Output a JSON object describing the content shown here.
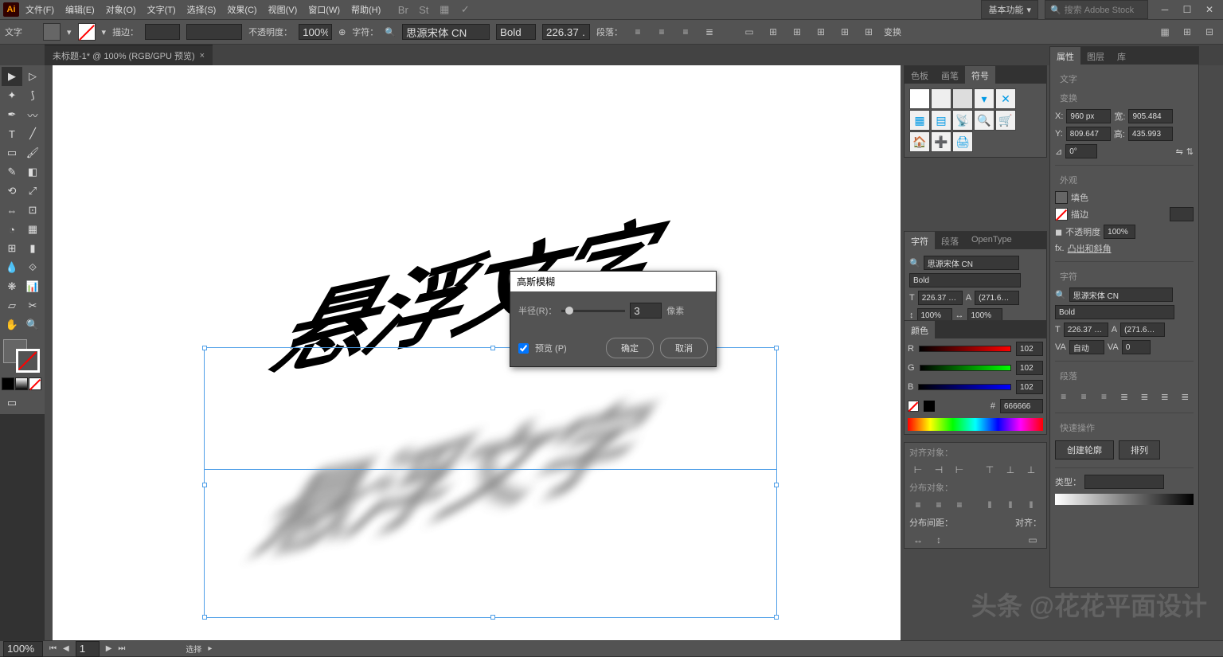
{
  "menu": {
    "items": [
      "文件(F)",
      "编辑(E)",
      "对象(O)",
      "文字(T)",
      "选择(S)",
      "效果(C)",
      "视图(V)",
      "窗口(W)",
      "帮助(H)"
    ],
    "workspace": "基本功能",
    "search_ph": "搜索 Adobe Stock"
  },
  "control": {
    "tool": "文字",
    "stroke_label": "描边：",
    "opacity_label": "不透明度：",
    "opacity": "100%",
    "char_label": "字符：",
    "font": "思源宋体 CN",
    "weight": "Bold",
    "size": "226.37 …",
    "para_label": "段落：",
    "transform": "变换"
  },
  "tab": {
    "title": "未标题-1* @ 100% (RGB/GPU 预览)"
  },
  "canvas": {
    "text": "悬浮文字"
  },
  "dialog": {
    "title": "高斯模糊",
    "radius_label": "半径(R)：",
    "value": "3",
    "unit": "像素",
    "preview": "预览 (P)",
    "ok": "确定",
    "cancel": "取消"
  },
  "panel_symbols": {
    "tabs": [
      "色板",
      "画笔",
      "符号"
    ]
  },
  "panel_char": {
    "tabs": [
      "字符",
      "段落",
      "OpenType"
    ],
    "font": "思源宋体 CN",
    "weight": "Bold",
    "size": "226.37 …",
    "leading": "(271.6…",
    "hscale": "100%",
    "vscale": "100%"
  },
  "panel_color": {
    "title": "颜色",
    "r": "102",
    "g": "102",
    "b": "102",
    "hex": "666666"
  },
  "panel_align": {
    "align_label": "对齐对象：",
    "dist_label": "分布对象：",
    "spacing": "分布间距：",
    "align_to": "对齐："
  },
  "panel_props": {
    "tabs": [
      "属性",
      "图层",
      "库"
    ],
    "tool": "文字",
    "transform": "变换",
    "x": "960 px",
    "y": "809.647",
    "w": "905.484",
    "h": "435.993",
    "angle": "0°",
    "appearance": "外观",
    "fill": "填色",
    "stroke": "描边",
    "opacity_l": "不透明度",
    "opacity": "100%",
    "fx": "fx.",
    "fx_label": "凸出和斜角",
    "char_section": "字符",
    "font": "思源宋体 CN",
    "weight": "Bold",
    "size": "226.37 …",
    "leading": "(271.6…",
    "auto": "自动",
    "kern": "0",
    "para_section": "段落",
    "actions": "快速操作",
    "outline": "创建轮廓",
    "arrange": "排列",
    "type_l": "类型："
  },
  "status": {
    "zoom": "100%",
    "page": "1",
    "mode": "选择"
  },
  "watermark": "头条 @花花平面设计"
}
